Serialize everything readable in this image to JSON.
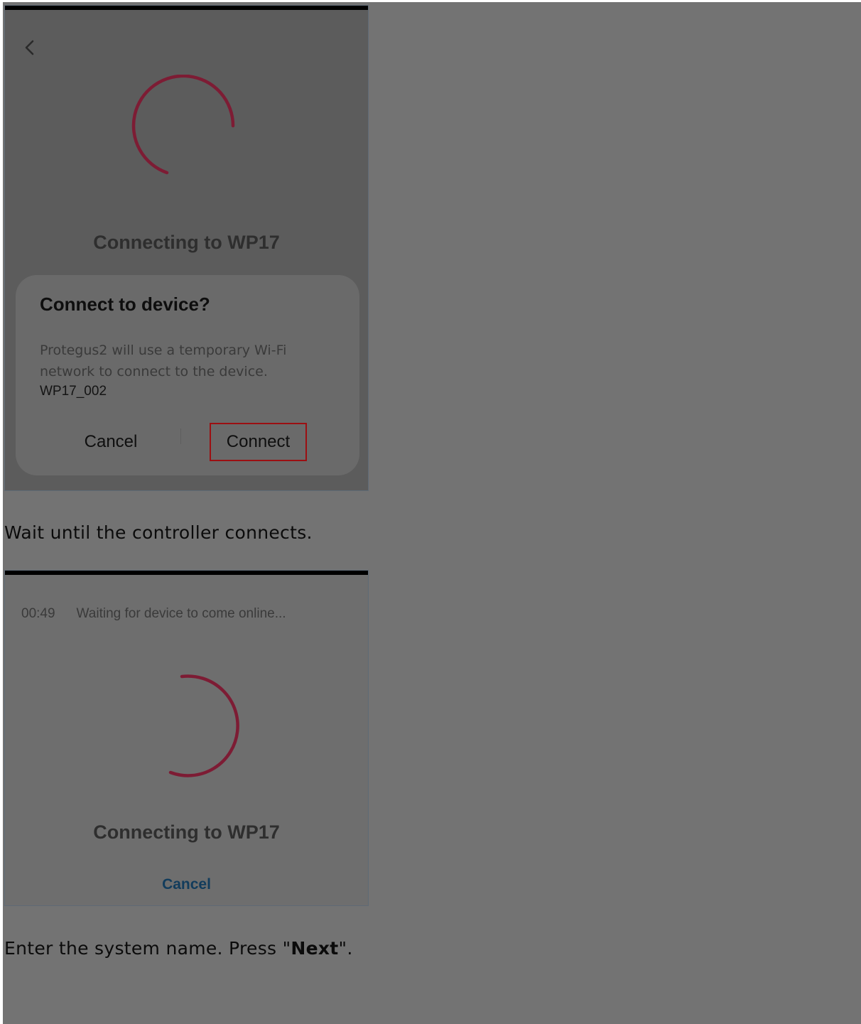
{
  "colors": {
    "background": "#737373",
    "spinner": "#7d1c34",
    "highlight_border": "#9c0f12",
    "link": "#123c5c"
  },
  "screen1": {
    "back_icon": "chevron-left-icon",
    "spinner_icon": "spinner-icon",
    "title": "Connecting to WP17",
    "dialog": {
      "title": "Connect to device?",
      "body": "Protegus2 will use a temporary Wi-Fi network to connect to the device.",
      "ssid": "WP17_002",
      "cancel_label": "Cancel",
      "connect_label": "Connect"
    }
  },
  "caption1": "Wait until the controller connects.",
  "screen2": {
    "timer": "00:49",
    "status": "Waiting for device to come online...",
    "spinner_icon": "spinner-icon",
    "title": "Connecting to WP17",
    "cancel_label": "Cancel"
  },
  "caption2": {
    "before": "Enter the system name. Press \"",
    "bold": "Next",
    "after": "\"."
  }
}
